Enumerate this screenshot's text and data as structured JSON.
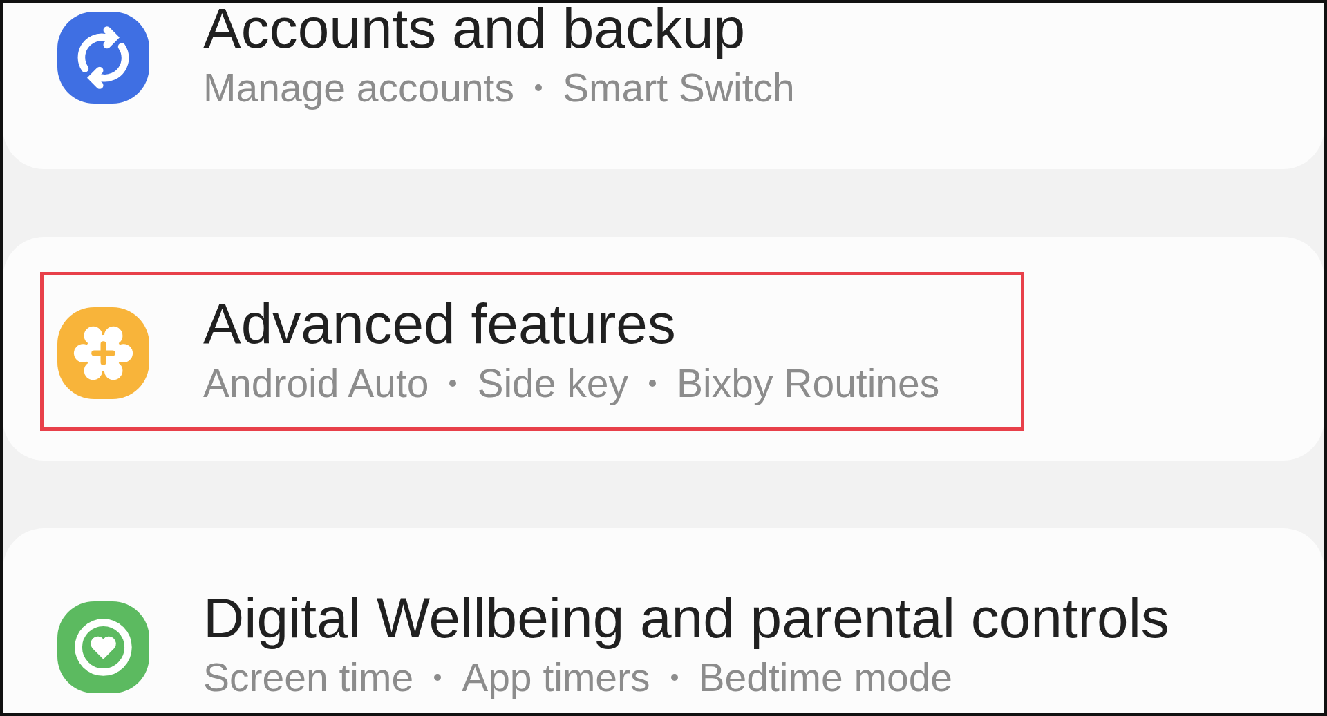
{
  "settings_items": [
    {
      "kind": "sync",
      "color": "#3f6fe3",
      "title": "Accounts and backup",
      "subtitle_parts": [
        "Manage accounts",
        "Smart Switch"
      ],
      "highlighted": false
    },
    {
      "kind": "gear-plus",
      "color": "#f8b43a",
      "title": "Advanced features",
      "subtitle_parts": [
        "Android Auto",
        "Side key",
        "Bixby Routines"
      ],
      "highlighted": true
    },
    {
      "kind": "heart-ring",
      "color": "#5cba60",
      "title": "Digital Wellbeing and parental controls",
      "subtitle_parts": [
        "Screen time",
        "App timers",
        "Bedtime mode"
      ],
      "highlighted": false
    }
  ]
}
